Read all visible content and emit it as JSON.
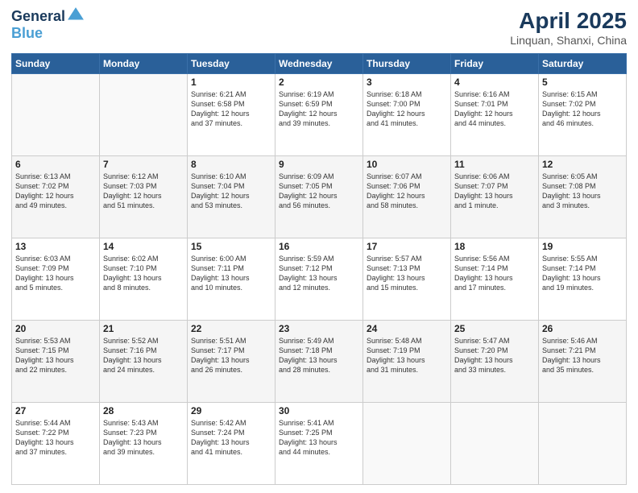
{
  "header": {
    "logo_line1": "General",
    "logo_line2": "Blue",
    "title": "April 2025",
    "subtitle": "Linquan, Shanxi, China"
  },
  "weekdays": [
    "Sunday",
    "Monday",
    "Tuesday",
    "Wednesday",
    "Thursday",
    "Friday",
    "Saturday"
  ],
  "weeks": [
    [
      {
        "day": "",
        "info": ""
      },
      {
        "day": "",
        "info": ""
      },
      {
        "day": "1",
        "info": "Sunrise: 6:21 AM\nSunset: 6:58 PM\nDaylight: 12 hours\nand 37 minutes."
      },
      {
        "day": "2",
        "info": "Sunrise: 6:19 AM\nSunset: 6:59 PM\nDaylight: 12 hours\nand 39 minutes."
      },
      {
        "day": "3",
        "info": "Sunrise: 6:18 AM\nSunset: 7:00 PM\nDaylight: 12 hours\nand 41 minutes."
      },
      {
        "day": "4",
        "info": "Sunrise: 6:16 AM\nSunset: 7:01 PM\nDaylight: 12 hours\nand 44 minutes."
      },
      {
        "day": "5",
        "info": "Sunrise: 6:15 AM\nSunset: 7:02 PM\nDaylight: 12 hours\nand 46 minutes."
      }
    ],
    [
      {
        "day": "6",
        "info": "Sunrise: 6:13 AM\nSunset: 7:02 PM\nDaylight: 12 hours\nand 49 minutes."
      },
      {
        "day": "7",
        "info": "Sunrise: 6:12 AM\nSunset: 7:03 PM\nDaylight: 12 hours\nand 51 minutes."
      },
      {
        "day": "8",
        "info": "Sunrise: 6:10 AM\nSunset: 7:04 PM\nDaylight: 12 hours\nand 53 minutes."
      },
      {
        "day": "9",
        "info": "Sunrise: 6:09 AM\nSunset: 7:05 PM\nDaylight: 12 hours\nand 56 minutes."
      },
      {
        "day": "10",
        "info": "Sunrise: 6:07 AM\nSunset: 7:06 PM\nDaylight: 12 hours\nand 58 minutes."
      },
      {
        "day": "11",
        "info": "Sunrise: 6:06 AM\nSunset: 7:07 PM\nDaylight: 13 hours\nand 1 minute."
      },
      {
        "day": "12",
        "info": "Sunrise: 6:05 AM\nSunset: 7:08 PM\nDaylight: 13 hours\nand 3 minutes."
      }
    ],
    [
      {
        "day": "13",
        "info": "Sunrise: 6:03 AM\nSunset: 7:09 PM\nDaylight: 13 hours\nand 5 minutes."
      },
      {
        "day": "14",
        "info": "Sunrise: 6:02 AM\nSunset: 7:10 PM\nDaylight: 13 hours\nand 8 minutes."
      },
      {
        "day": "15",
        "info": "Sunrise: 6:00 AM\nSunset: 7:11 PM\nDaylight: 13 hours\nand 10 minutes."
      },
      {
        "day": "16",
        "info": "Sunrise: 5:59 AM\nSunset: 7:12 PM\nDaylight: 13 hours\nand 12 minutes."
      },
      {
        "day": "17",
        "info": "Sunrise: 5:57 AM\nSunset: 7:13 PM\nDaylight: 13 hours\nand 15 minutes."
      },
      {
        "day": "18",
        "info": "Sunrise: 5:56 AM\nSunset: 7:14 PM\nDaylight: 13 hours\nand 17 minutes."
      },
      {
        "day": "19",
        "info": "Sunrise: 5:55 AM\nSunset: 7:14 PM\nDaylight: 13 hours\nand 19 minutes."
      }
    ],
    [
      {
        "day": "20",
        "info": "Sunrise: 5:53 AM\nSunset: 7:15 PM\nDaylight: 13 hours\nand 22 minutes."
      },
      {
        "day": "21",
        "info": "Sunrise: 5:52 AM\nSunset: 7:16 PM\nDaylight: 13 hours\nand 24 minutes."
      },
      {
        "day": "22",
        "info": "Sunrise: 5:51 AM\nSunset: 7:17 PM\nDaylight: 13 hours\nand 26 minutes."
      },
      {
        "day": "23",
        "info": "Sunrise: 5:49 AM\nSunset: 7:18 PM\nDaylight: 13 hours\nand 28 minutes."
      },
      {
        "day": "24",
        "info": "Sunrise: 5:48 AM\nSunset: 7:19 PM\nDaylight: 13 hours\nand 31 minutes."
      },
      {
        "day": "25",
        "info": "Sunrise: 5:47 AM\nSunset: 7:20 PM\nDaylight: 13 hours\nand 33 minutes."
      },
      {
        "day": "26",
        "info": "Sunrise: 5:46 AM\nSunset: 7:21 PM\nDaylight: 13 hours\nand 35 minutes."
      }
    ],
    [
      {
        "day": "27",
        "info": "Sunrise: 5:44 AM\nSunset: 7:22 PM\nDaylight: 13 hours\nand 37 minutes."
      },
      {
        "day": "28",
        "info": "Sunrise: 5:43 AM\nSunset: 7:23 PM\nDaylight: 13 hours\nand 39 minutes."
      },
      {
        "day": "29",
        "info": "Sunrise: 5:42 AM\nSunset: 7:24 PM\nDaylight: 13 hours\nand 41 minutes."
      },
      {
        "day": "30",
        "info": "Sunrise: 5:41 AM\nSunset: 7:25 PM\nDaylight: 13 hours\nand 44 minutes."
      },
      {
        "day": "",
        "info": ""
      },
      {
        "day": "",
        "info": ""
      },
      {
        "day": "",
        "info": ""
      }
    ]
  ]
}
